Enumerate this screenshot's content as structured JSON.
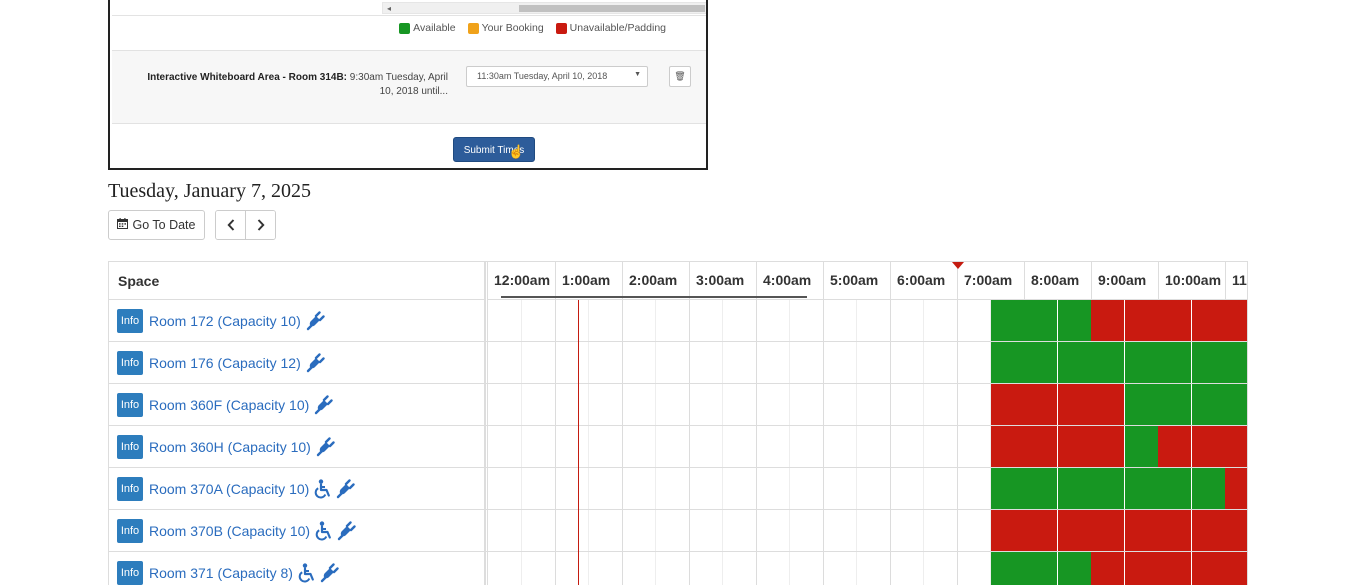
{
  "embedded_screenshot": {
    "legend": [
      {
        "label": "Available",
        "color": "#179623"
      },
      {
        "label": "Your Booking",
        "color": "#f0a21a"
      },
      {
        "label": "Unavailable/Padding",
        "color": "#c91a10"
      }
    ],
    "booking_space": "Interactive Whiteboard Area - Room 314B",
    "booking_start": "9:30am Tuesday, April 10, 2018 until...",
    "end_time_value": "11:30am Tuesday, April 10, 2018",
    "submit_label": "Submit Times"
  },
  "date_heading": "Tuesday, January 7, 2025",
  "go_to_date_label": "Go To Date",
  "grid": {
    "space_header": "Space",
    "hours": [
      "12:00am",
      "1:00am",
      "2:00am",
      "3:00am",
      "4:00am",
      "5:00am",
      "6:00am",
      "7:00am",
      "8:00am",
      "9:00am",
      "10:00am",
      "11:"
    ],
    "info_label": "Info",
    "colors": {
      "available": "#179623",
      "unavailable": "#c91a10",
      "now": "#c41b10"
    },
    "rows": [
      {
        "name": "Room 172 (Capacity 10)",
        "features": [
          "power-plug-icon"
        ],
        "slots": "AAAUUUUU"
      },
      {
        "name": "Room 176 (Capacity 12)",
        "features": [
          "power-plug-icon"
        ],
        "slots": "AAAAAAAA"
      },
      {
        "name": "Room 360F (Capacity 10)",
        "features": [
          "power-plug-icon"
        ],
        "slots": "UUUUAAAA"
      },
      {
        "name": "Room 360H (Capacity 10)",
        "features": [
          "power-plug-icon"
        ],
        "slots": "UUUUAUUU"
      },
      {
        "name": "Room 370A (Capacity 10)",
        "features": [
          "wheelchair-icon",
          "power-plug-icon"
        ],
        "slots": "AAAAAAAU"
      },
      {
        "name": "Room 370B (Capacity 10)",
        "features": [
          "wheelchair-icon",
          "power-plug-icon"
        ],
        "slots": "UUUUUUUU"
      },
      {
        "name": "Room 371 (Capacity 8)",
        "features": [
          "wheelchair-icon",
          "power-plug-icon"
        ],
        "slots": "AAAUUUUU"
      }
    ]
  }
}
